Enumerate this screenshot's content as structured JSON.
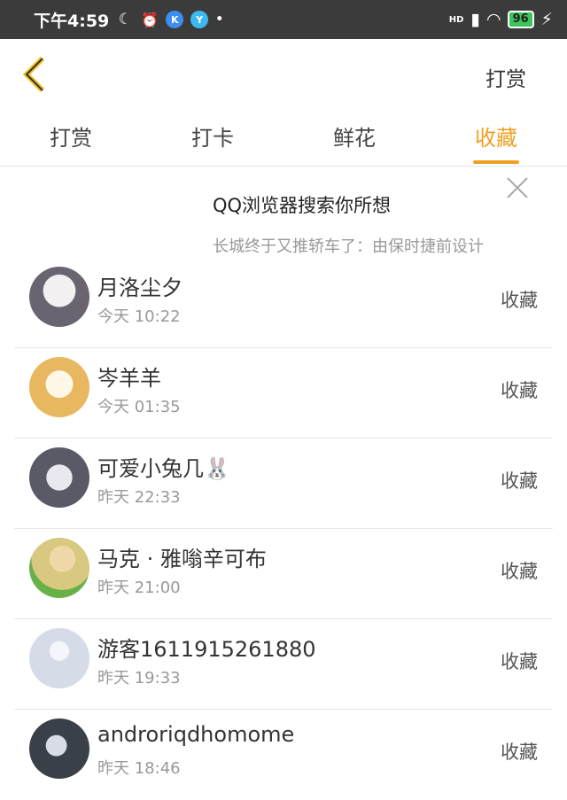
{
  "statusbar": {
    "time": "下午4:59",
    "signal": "HD",
    "battery": "96"
  },
  "header": {
    "action": "打赏"
  },
  "tabs": [
    {
      "label": "打赏"
    },
    {
      "label": "打卡"
    },
    {
      "label": "鲜花"
    },
    {
      "label": "收藏",
      "active": true
    }
  ],
  "ad": {
    "title": "QQ浏览器搜索你所想",
    "subtitle": "长城终于又推轿车了：由保时捷前设计"
  },
  "list": [
    {
      "name": "月洛尘夕",
      "time": "今天 10:22",
      "action": "收藏",
      "avatar_color": "#6a6470"
    },
    {
      "name": "岑羊羊",
      "time": "今天 01:35",
      "action": "收藏",
      "avatar_color": "#e8b860"
    },
    {
      "name": "可爱小兔几🐰",
      "time": "昨天 22:33",
      "action": "收藏",
      "avatar_color": "#5a5a66"
    },
    {
      "name": "马克 · 雅嗡辛可布",
      "time": "昨天 21:00",
      "action": "收藏",
      "avatar_color": "#d8c880"
    },
    {
      "name": "游客1611915261880",
      "time": "昨天 19:33",
      "action": "收藏",
      "avatar_color": "#d6dbe8"
    },
    {
      "name": "androriqdhomome",
      "time": "昨天 18:46",
      "action": "收藏",
      "avatar_color": "#3a4048"
    }
  ],
  "colors": {
    "accent": "#f0a020",
    "statusbar": "#3b3b3b"
  }
}
